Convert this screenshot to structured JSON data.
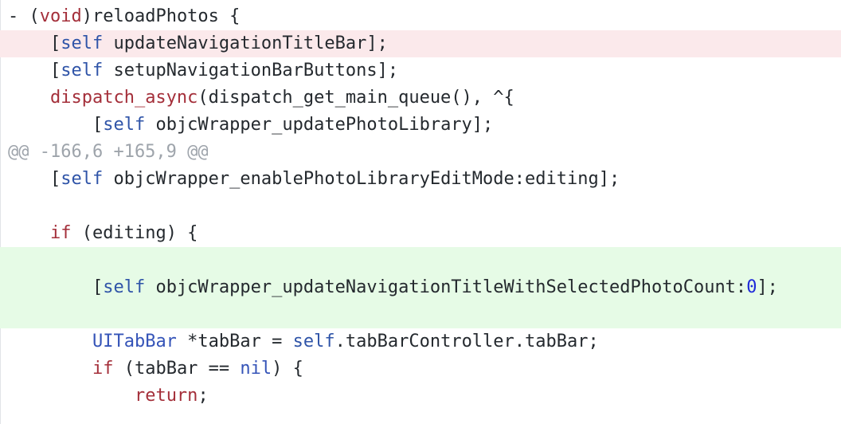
{
  "diff": {
    "lines": [
      {
        "type": "context",
        "indent": "",
        "tokens": [
          [
            "",
            "- ("
          ],
          [
            "kw",
            "void"
          ],
          [
            "",
            ")reloadPhotos {"
          ]
        ]
      },
      {
        "type": "del",
        "indent": "    ",
        "tokens": [
          [
            "",
            "["
          ],
          [
            "sf",
            "self"
          ],
          [
            "",
            " updateNavigationTitleBar];"
          ]
        ]
      },
      {
        "type": "context",
        "indent": "    ",
        "tokens": [
          [
            "",
            "["
          ],
          [
            "sf",
            "self"
          ],
          [
            "",
            " setupNavigationBarButtons];"
          ]
        ]
      },
      {
        "type": "context",
        "indent": "    ",
        "tokens": [
          [
            "fn",
            "dispatch_async"
          ],
          [
            "",
            "(dispatch_get_main_queue(), ^{"
          ]
        ]
      },
      {
        "type": "context",
        "indent": "        ",
        "tokens": [
          [
            "",
            "["
          ],
          [
            "sf",
            "self"
          ],
          [
            "",
            " objcWrapper_updatePhotoLibrary];"
          ]
        ]
      },
      {
        "type": "hunk",
        "indent": "",
        "tokens": [
          [
            "",
            "@@ -166,6 +165,9 @@"
          ]
        ]
      },
      {
        "type": "context",
        "indent": "    ",
        "tokens": [
          [
            "",
            "["
          ],
          [
            "sf",
            "self"
          ],
          [
            "",
            " objcWrapper_enablePhotoLibraryEditMode:editing];"
          ]
        ]
      },
      {
        "type": "context",
        "indent": "",
        "tokens": [
          [
            "",
            ""
          ]
        ]
      },
      {
        "type": "context",
        "indent": "    ",
        "tokens": [
          [
            "kw",
            "if"
          ],
          [
            "",
            " (editing) {"
          ]
        ]
      },
      {
        "type": "add-tall",
        "indent": "        ",
        "tokens": [
          [
            "",
            "["
          ],
          [
            "sf",
            "self"
          ],
          [
            "",
            " objcWrapper_updateNavigationTitleWithSelectedPhotoCount:"
          ],
          [
            "num",
            "0"
          ],
          [
            "",
            "];"
          ]
        ]
      },
      {
        "type": "context",
        "indent": "        ",
        "tokens": [
          [
            "ty",
            "UITabBar"
          ],
          [
            "",
            " *tabBar = "
          ],
          [
            "sf",
            "self"
          ],
          [
            "",
            ".tabBarController.tabBar;"
          ]
        ]
      },
      {
        "type": "context",
        "indent": "        ",
        "tokens": [
          [
            "kw",
            "if"
          ],
          [
            "",
            " (tabBar == "
          ],
          [
            "ty",
            "nil"
          ],
          [
            "",
            ") {"
          ]
        ]
      },
      {
        "type": "context",
        "indent": "            ",
        "tokens": [
          [
            "kw",
            "return"
          ],
          [
            "",
            ";"
          ]
        ]
      }
    ]
  }
}
